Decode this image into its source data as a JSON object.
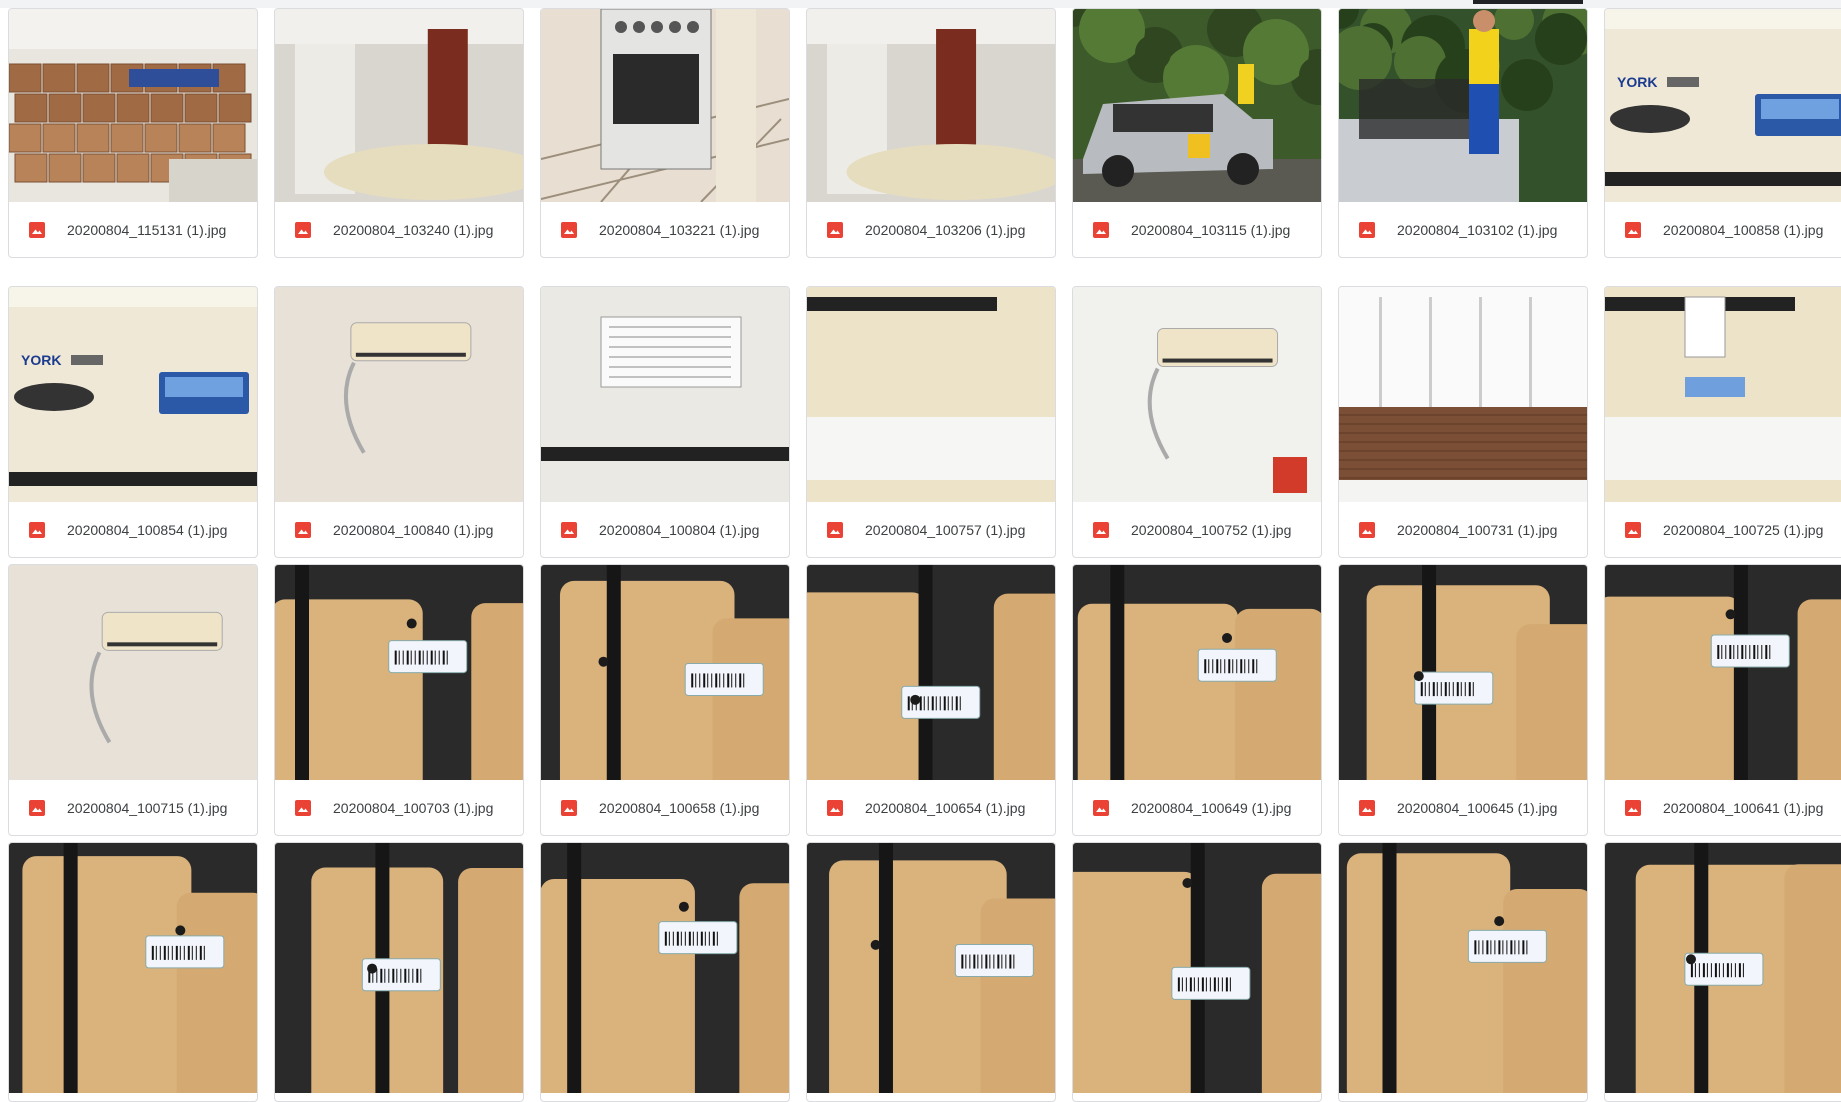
{
  "files": [
    {
      "name": "20200804_115131 (1).jpg",
      "thumb": "warehouse-boxes"
    },
    {
      "name": "20200804_103240 (1).jpg",
      "thumb": "room-table"
    },
    {
      "name": "20200804_103221 (1).jpg",
      "thumb": "stove"
    },
    {
      "name": "20200804_103206 (1).jpg",
      "thumb": "room-table"
    },
    {
      "name": "20200804_103115 (1).jpg",
      "thumb": "pickup-truck"
    },
    {
      "name": "20200804_103102 (1).jpg",
      "thumb": "truck-bed"
    },
    {
      "name": "20200804_100858 (1).jpg",
      "thumb": "ac-unit-label"
    },
    {
      "name": "20200804_100854 (1).jpg",
      "thumb": "ac-unit-label"
    },
    {
      "name": "20200804_100840 (1).jpg",
      "thumb": "wall-ac"
    },
    {
      "name": "20200804_100804 (1).jpg",
      "thumb": "ac-sticker"
    },
    {
      "name": "20200804_100757 (1).jpg",
      "thumb": "ac-closeup"
    },
    {
      "name": "20200804_100752 (1).jpg",
      "thumb": "wall-ac"
    },
    {
      "name": "20200804_100731 (1).jpg",
      "thumb": "empty-room"
    },
    {
      "name": "20200804_100725 (1).jpg",
      "thumb": "ac-closeup"
    },
    {
      "name": "20200804_100715 (1).jpg",
      "thumb": "wall-ac"
    },
    {
      "name": "20200804_100703 (1).jpg",
      "thumb": "plywood-tag"
    },
    {
      "name": "20200804_100658 (1).jpg",
      "thumb": "plywood-tag"
    },
    {
      "name": "20200804_100654 (1).jpg",
      "thumb": "plywood-tag"
    },
    {
      "name": "20200804_100649 (1).jpg",
      "thumb": "plywood-tag"
    },
    {
      "name": "20200804_100645 (1).jpg",
      "thumb": "plywood-tag"
    },
    {
      "name": "20200804_100641 (1).jpg",
      "thumb": "plywood-tag"
    },
    {
      "name": "",
      "thumb": "plywood-tag"
    },
    {
      "name": "",
      "thumb": "plywood-tag"
    },
    {
      "name": "",
      "thumb": "plywood-tag"
    },
    {
      "name": "",
      "thumb": "plywood-tag"
    },
    {
      "name": "",
      "thumb": "plywood-tag"
    },
    {
      "name": "",
      "thumb": "plywood-tag"
    },
    {
      "name": "",
      "thumb": "plywood-tag"
    }
  ],
  "thumb_labels": {
    "york": "YORK"
  },
  "colors": {
    "image_icon": "#ea4335",
    "tile_border": "#dadce0",
    "filename_text": "#3c4043"
  }
}
